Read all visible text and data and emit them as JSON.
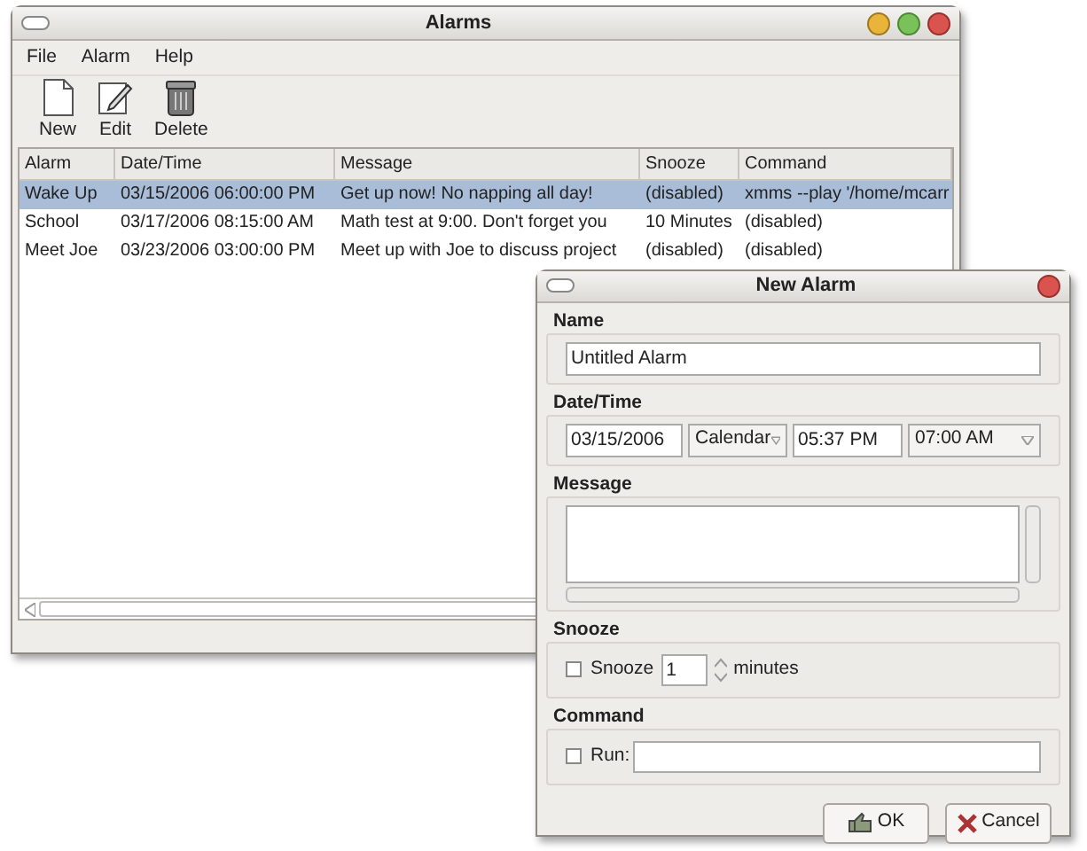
{
  "main_window": {
    "title": "Alarms",
    "menu": [
      {
        "label": "File"
      },
      {
        "label": "Alarm"
      },
      {
        "label": "Help"
      }
    ],
    "toolbar": [
      {
        "label": "New",
        "kind": "new"
      },
      {
        "label": "Edit",
        "kind": "edit"
      },
      {
        "label": "Delete",
        "kind": "delete"
      }
    ],
    "table": {
      "columns": [
        "Alarm",
        "Date/Time",
        "Message",
        "Snooze",
        "Command"
      ],
      "rows": [
        {
          "cells": [
            "Wake Up",
            "03/15/2006 06:00:00 PM",
            "Get up now!  No napping all day!",
            "(disabled)",
            "xmms --play '/home/mcarr"
          ],
          "selected": true
        },
        {
          "cells": [
            "School",
            "03/17/2006 08:15:00 AM",
            "Math test at 9:00. Don't forget you",
            "10 Minutes",
            "(disabled)"
          ],
          "selected": false
        },
        {
          "cells": [
            "Meet Joe",
            "03/23/2006 03:00:00 PM",
            "Meet up with Joe to discuss project",
            "(disabled)",
            "(disabled)"
          ],
          "selected": false
        }
      ]
    }
  },
  "dialog": {
    "title": "New Alarm",
    "name": {
      "label": "Name",
      "value": "Untitled Alarm"
    },
    "datetime": {
      "label": "Date/Time",
      "date": "03/15/2006",
      "mode": "Calendar",
      "time": "05:37 PM",
      "preset": "07:00 AM"
    },
    "message": {
      "label": "Message"
    },
    "snooze": {
      "label": "Snooze",
      "checkbox_label": "Snooze",
      "checked": false,
      "value": "1",
      "unit": "minutes"
    },
    "command": {
      "label": "Command",
      "checkbox_label": "Run:",
      "checked": false
    },
    "buttons": [
      {
        "label": "OK",
        "kind": "ok"
      },
      {
        "label": "Cancel",
        "kind": "cancel"
      }
    ]
  }
}
